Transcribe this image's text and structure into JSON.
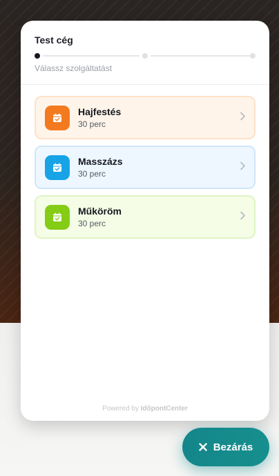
{
  "widget": {
    "title": "Test cég",
    "step_label": "Válassz szolgáltatást",
    "steps_total": 3,
    "current_step": 1
  },
  "services": [
    {
      "name": "Hajfestés",
      "duration": "30 perc",
      "icon": "calendar-check-icon",
      "color": "#f47a1f"
    },
    {
      "name": "Masszázs",
      "duration": "30 perc",
      "icon": "calendar-check-icon",
      "color": "#17a3e6"
    },
    {
      "name": "Műköröm",
      "duration": "30 perc",
      "icon": "calendar-check-icon",
      "color": "#84cc16"
    }
  ],
  "footer": {
    "powered_by": "Powered by",
    "brand": "IdőpontCenter"
  },
  "close_button": {
    "label": "Bezárás",
    "icon": "close-icon"
  }
}
